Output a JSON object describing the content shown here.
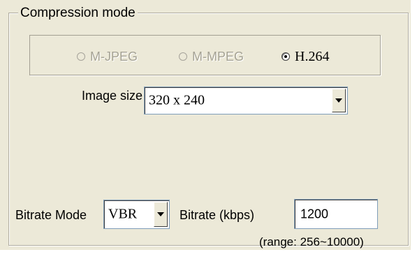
{
  "compression": {
    "group_title": "Compression mode",
    "options": [
      {
        "label": "M-JPEG",
        "selected": false,
        "enabled": false
      },
      {
        "label": "M-MPEG",
        "selected": false,
        "enabled": false
      },
      {
        "label": "H.264",
        "selected": true,
        "enabled": true
      }
    ]
  },
  "image_size": {
    "label": "Image size",
    "value": "320 x 240"
  },
  "bitrate": {
    "mode_label": "Bitrate Mode",
    "mode_value": "VBR",
    "rate_label": "Bitrate (kbps)",
    "rate_value": "1200",
    "range_note": "(range: 256~10000)"
  },
  "colors": {
    "panel_bg": "#ece9d8",
    "disabled_text": "#a5a293"
  },
  "icons": [
    "radio-icon",
    "chevron-down-icon"
  ]
}
